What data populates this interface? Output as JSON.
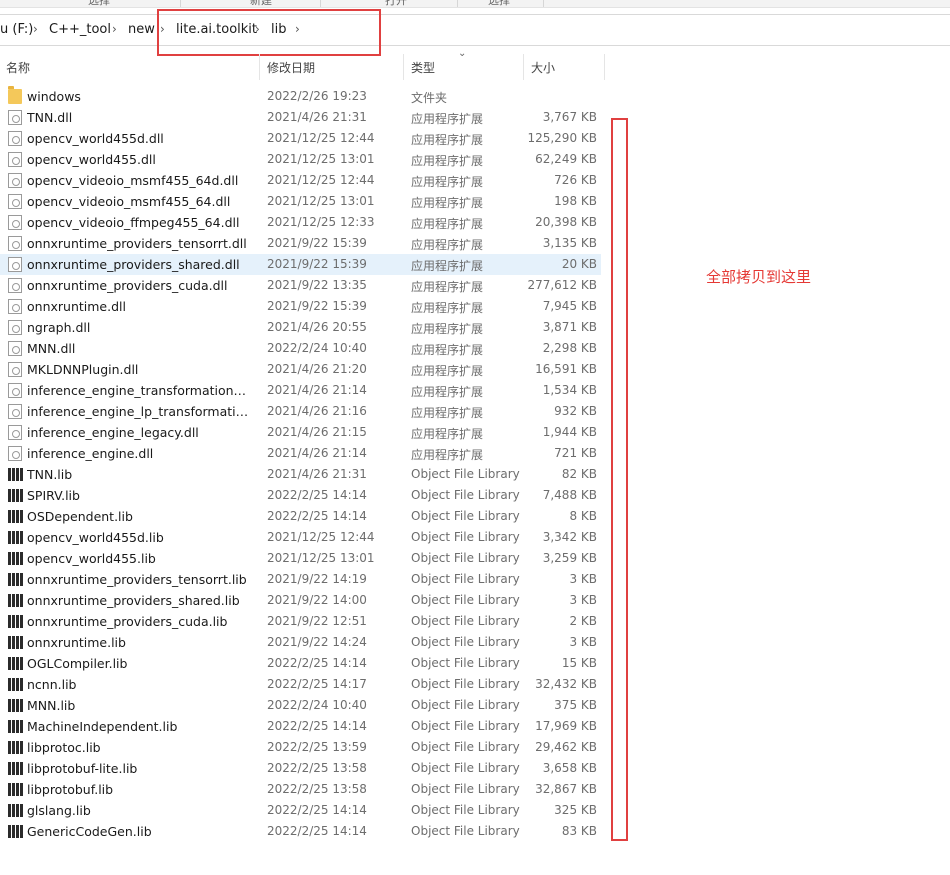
{
  "toolbar": {
    "labels": [
      "选择",
      "新建",
      "打开",
      "选择"
    ]
  },
  "breadcrumb": {
    "drive": "u (F:)",
    "items": [
      "C++_tool",
      "new",
      "lite.ai.toolkit",
      "lib"
    ]
  },
  "columns": {
    "name": "名称",
    "date": "修改日期",
    "type": "类型",
    "size": "大小"
  },
  "annotation": "全部拷贝到这里",
  "colors": {
    "highlight": "#e04040",
    "annotation": "#e53935",
    "selected_row": "#e5f1fb"
  },
  "files": [
    {
      "name": "windows",
      "date": "2022/2/26 19:23",
      "type": "文件夹",
      "size": "",
      "icon": "folder-icon"
    },
    {
      "name": "TNN.dll",
      "date": "2021/4/26 21:31",
      "type": "应用程序扩展",
      "size": "3,767 KB",
      "icon": "dll-icon"
    },
    {
      "name": "opencv_world455d.dll",
      "date": "2021/12/25 12:44",
      "type": "应用程序扩展",
      "size": "125,290 KB",
      "icon": "dll-icon"
    },
    {
      "name": "opencv_world455.dll",
      "date": "2021/12/25 13:01",
      "type": "应用程序扩展",
      "size": "62,249 KB",
      "icon": "dll-icon"
    },
    {
      "name": "opencv_videoio_msmf455_64d.dll",
      "date": "2021/12/25 12:44",
      "type": "应用程序扩展",
      "size": "726 KB",
      "icon": "dll-icon"
    },
    {
      "name": "opencv_videoio_msmf455_64.dll",
      "date": "2021/12/25 13:01",
      "type": "应用程序扩展",
      "size": "198 KB",
      "icon": "dll-icon"
    },
    {
      "name": "opencv_videoio_ffmpeg455_64.dll",
      "date": "2021/12/25 12:33",
      "type": "应用程序扩展",
      "size": "20,398 KB",
      "icon": "dll-icon"
    },
    {
      "name": "onnxruntime_providers_tensorrt.dll",
      "date": "2021/9/22 15:39",
      "type": "应用程序扩展",
      "size": "3,135 KB",
      "icon": "dll-icon"
    },
    {
      "name": "onnxruntime_providers_shared.dll",
      "date": "2021/9/22 15:39",
      "type": "应用程序扩展",
      "size": "20 KB",
      "icon": "dll-icon",
      "selected": true
    },
    {
      "name": "onnxruntime_providers_cuda.dll",
      "date": "2021/9/22 13:35",
      "type": "应用程序扩展",
      "size": "277,612 KB",
      "icon": "dll-icon"
    },
    {
      "name": "onnxruntime.dll",
      "date": "2021/9/22 15:39",
      "type": "应用程序扩展",
      "size": "7,945 KB",
      "icon": "dll-icon"
    },
    {
      "name": "ngraph.dll",
      "date": "2021/4/26 20:55",
      "type": "应用程序扩展",
      "size": "3,871 KB",
      "icon": "dll-icon"
    },
    {
      "name": "MNN.dll",
      "date": "2022/2/24 10:40",
      "type": "应用程序扩展",
      "size": "2,298 KB",
      "icon": "dll-icon"
    },
    {
      "name": "MKLDNNPlugin.dll",
      "date": "2021/4/26 21:20",
      "type": "应用程序扩展",
      "size": "16,591 KB",
      "icon": "dll-icon"
    },
    {
      "name": "inference_engine_transformations.dll",
      "date": "2021/4/26 21:14",
      "type": "应用程序扩展",
      "size": "1,534 KB",
      "icon": "dll-icon"
    },
    {
      "name": "inference_engine_lp_transformations....",
      "date": "2021/4/26 21:16",
      "type": "应用程序扩展",
      "size": "932 KB",
      "icon": "dll-icon"
    },
    {
      "name": "inference_engine_legacy.dll",
      "date": "2021/4/26 21:15",
      "type": "应用程序扩展",
      "size": "1,944 KB",
      "icon": "dll-icon"
    },
    {
      "name": "inference_engine.dll",
      "date": "2021/4/26 21:14",
      "type": "应用程序扩展",
      "size": "721 KB",
      "icon": "dll-icon"
    },
    {
      "name": "TNN.lib",
      "date": "2021/4/26 21:31",
      "type": "Object File Library",
      "size": "82 KB",
      "icon": "lib-icon"
    },
    {
      "name": "SPIRV.lib",
      "date": "2022/2/25 14:14",
      "type": "Object File Library",
      "size": "7,488 KB",
      "icon": "lib-icon"
    },
    {
      "name": "OSDependent.lib",
      "date": "2022/2/25 14:14",
      "type": "Object File Library",
      "size": "8 KB",
      "icon": "lib-icon"
    },
    {
      "name": "opencv_world455d.lib",
      "date": "2021/12/25 12:44",
      "type": "Object File Library",
      "size": "3,342 KB",
      "icon": "lib-icon"
    },
    {
      "name": "opencv_world455.lib",
      "date": "2021/12/25 13:01",
      "type": "Object File Library",
      "size": "3,259 KB",
      "icon": "lib-icon"
    },
    {
      "name": "onnxruntime_providers_tensorrt.lib",
      "date": "2021/9/22 14:19",
      "type": "Object File Library",
      "size": "3 KB",
      "icon": "lib-icon"
    },
    {
      "name": "onnxruntime_providers_shared.lib",
      "date": "2021/9/22 14:00",
      "type": "Object File Library",
      "size": "3 KB",
      "icon": "lib-icon"
    },
    {
      "name": "onnxruntime_providers_cuda.lib",
      "date": "2021/9/22 12:51",
      "type": "Object File Library",
      "size": "2 KB",
      "icon": "lib-icon"
    },
    {
      "name": "onnxruntime.lib",
      "date": "2021/9/22 14:24",
      "type": "Object File Library",
      "size": "3 KB",
      "icon": "lib-icon"
    },
    {
      "name": "OGLCompiler.lib",
      "date": "2022/2/25 14:14",
      "type": "Object File Library",
      "size": "15 KB",
      "icon": "lib-icon"
    },
    {
      "name": "ncnn.lib",
      "date": "2022/2/25 14:17",
      "type": "Object File Library",
      "size": "32,432 KB",
      "icon": "lib-icon"
    },
    {
      "name": "MNN.lib",
      "date": "2022/2/24 10:40",
      "type": "Object File Library",
      "size": "375 KB",
      "icon": "lib-icon"
    },
    {
      "name": "MachineIndependent.lib",
      "date": "2022/2/25 14:14",
      "type": "Object File Library",
      "size": "17,969 KB",
      "icon": "lib-icon"
    },
    {
      "name": "libprotoc.lib",
      "date": "2022/2/25 13:59",
      "type": "Object File Library",
      "size": "29,462 KB",
      "icon": "lib-icon"
    },
    {
      "name": "libprotobuf-lite.lib",
      "date": "2022/2/25 13:58",
      "type": "Object File Library",
      "size": "3,658 KB",
      "icon": "lib-icon"
    },
    {
      "name": "libprotobuf.lib",
      "date": "2022/2/25 13:58",
      "type": "Object File Library",
      "size": "32,867 KB",
      "icon": "lib-icon"
    },
    {
      "name": "glslang.lib",
      "date": "2022/2/25 14:14",
      "type": "Object File Library",
      "size": "325 KB",
      "icon": "lib-icon"
    },
    {
      "name": "GenericCodeGen.lib",
      "date": "2022/2/25 14:14",
      "type": "Object File Library",
      "size": "83 KB",
      "icon": "lib-icon"
    }
  ]
}
